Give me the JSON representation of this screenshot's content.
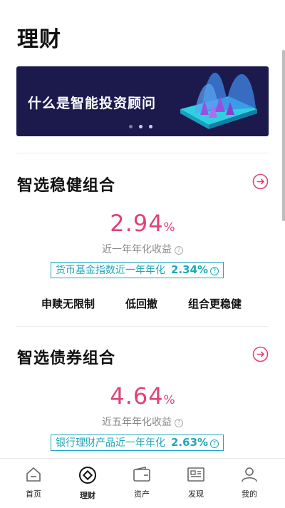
{
  "page": {
    "title": "理财"
  },
  "banner": {
    "text": "什么是智能投资顾问"
  },
  "sections": [
    {
      "title": "智选稳健组合",
      "rate_value": "2.94",
      "rate_unit": "%",
      "rate_label": "近一年年化收益",
      "compare_label": "货币基金指数近一年年化",
      "compare_value": "2.34%",
      "features": [
        "申赎无限制",
        "低回撤",
        "组合更稳健"
      ]
    },
    {
      "title": "智选债券组合",
      "rate_value": "4.64",
      "rate_unit": "%",
      "rate_label": "近五年年化收益",
      "compare_label": "银行理财产品近一年年化",
      "compare_value": "2.63%"
    }
  ],
  "tabbar": {
    "items": [
      {
        "label": "首页",
        "icon": "home-icon"
      },
      {
        "label": "理财",
        "icon": "finance-icon"
      },
      {
        "label": "资产",
        "icon": "wallet-icon"
      },
      {
        "label": "发现",
        "icon": "news-icon"
      },
      {
        "label": "我的",
        "icon": "profile-icon"
      }
    ],
    "active": "理财"
  },
  "colors": {
    "accent": "#e0427a",
    "teal": "#1fa7b8",
    "banner_bg": "#1c1a4d"
  }
}
